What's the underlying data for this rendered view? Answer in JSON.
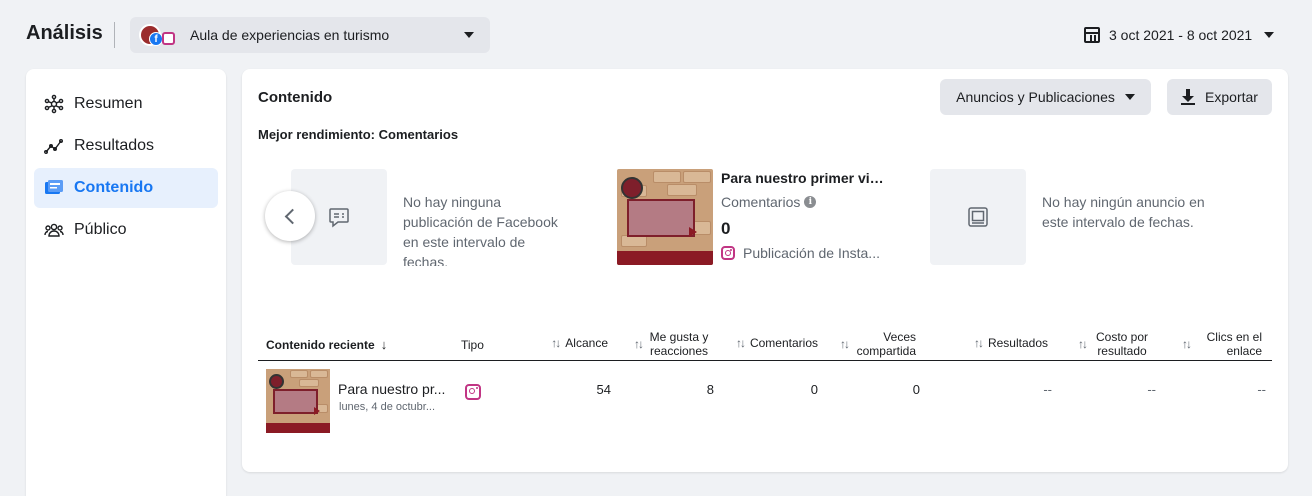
{
  "header": {
    "title": "Análisis",
    "account_name": "Aula de experiencias en turismo",
    "date_range": "3 oct 2021 - 8 oct 2021"
  },
  "sidebar": {
    "items": [
      {
        "label": "Resumen",
        "icon": "network-icon",
        "active": false
      },
      {
        "label": "Resultados",
        "icon": "trend-line-icon",
        "active": false
      },
      {
        "label": "Contenido",
        "icon": "content-cards-icon",
        "active": true
      },
      {
        "label": "Público",
        "icon": "people-icon",
        "active": false
      }
    ]
  },
  "main": {
    "title": "Contenido",
    "filter_label": "Anuncios y Publicaciones",
    "export_label": "Exportar",
    "best_performance": "Mejor rendimiento: Comentarios",
    "cards": {
      "facebook_empty": "No hay ninguna publicación de Facebook en este intervalo de fechas.",
      "post": {
        "title": "Para nuestro primer via...",
        "metric_label": "Comentarios",
        "metric_value": "0",
        "source": "Publicación de Insta..."
      },
      "ads_empty": "No hay ningún anuncio en este intervalo de fechas."
    },
    "table": {
      "headers": {
        "content": "Contenido reciente",
        "type": "Tipo",
        "reach": "Alcance",
        "likes": "Me gusta y reacciones",
        "comments": "Comentarios",
        "shares": "Veces compartida",
        "results": "Resultados",
        "cost": "Costo por resultado",
        "clicks": "Clics en el enlace"
      },
      "rows": [
        {
          "title": "Para nuestro pr...",
          "date": "lunes, 4 de octubr...",
          "type_icon": "instagram-icon",
          "reach": "54",
          "likes": "8",
          "comments": "0",
          "shares": "0",
          "results": "--",
          "cost": "--",
          "clicks": "--"
        }
      ]
    }
  },
  "colors": {
    "accent": "#1877f2",
    "active_bg": "#e7f0fd",
    "instagram": "#c13584"
  }
}
